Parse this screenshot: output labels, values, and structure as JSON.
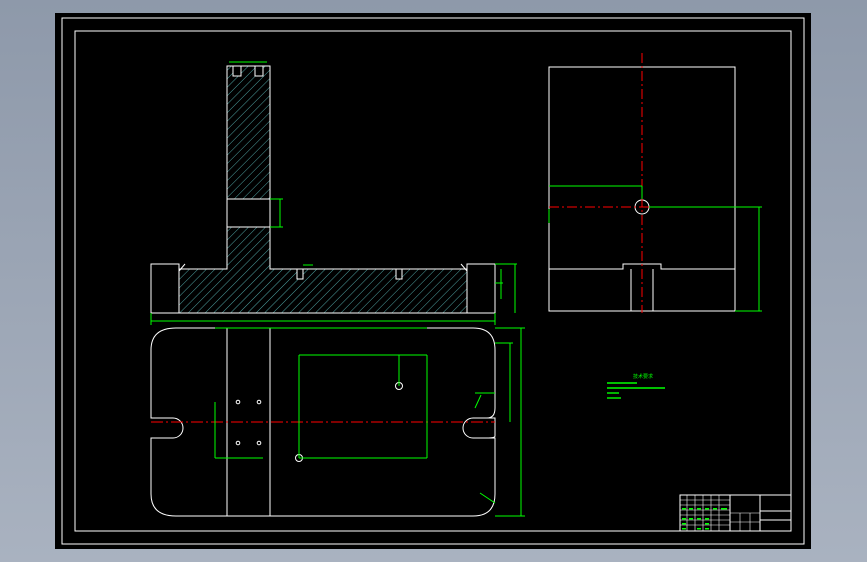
{
  "colors": {
    "background": "#000000",
    "outline": "#ffffff",
    "dimension": "#00ff00",
    "centerline": "#ff0000",
    "hatch": "#4fa3a3"
  },
  "notes": {
    "title": "技术要求"
  }
}
